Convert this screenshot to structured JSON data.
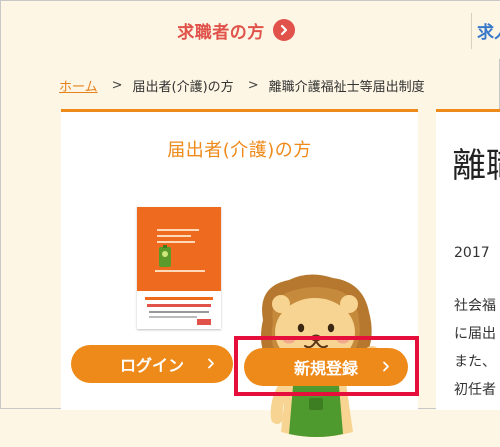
{
  "topnav": {
    "left_label": "求職者の方",
    "right_label": "求人"
  },
  "breadcrumb": {
    "home": "ホーム",
    "separator": ">",
    "items": [
      "届出者(介護)の方",
      "離職介護福祉士等届出制度"
    ]
  },
  "card": {
    "title": "届出者(介護)の方",
    "login_label": "ログイン",
    "register_label": "新規登録"
  },
  "article": {
    "title_partial": "離職",
    "date_partial": "2017",
    "lines": [
      "社会福",
      "に届出",
      "また、",
      "初任者"
    ]
  },
  "colors": {
    "accent": "#ee8a1a",
    "nav_red": "#e0524a",
    "nav_blue": "#3a79c9",
    "highlight": "#e60e3a",
    "background": "#fdf6e4"
  },
  "icons": {
    "nav_arrow": "chevron-right-circle-icon",
    "button_chevron": "chevron-right-icon",
    "mascot": "lion-mascot",
    "poster": "poster-thumbnail"
  }
}
